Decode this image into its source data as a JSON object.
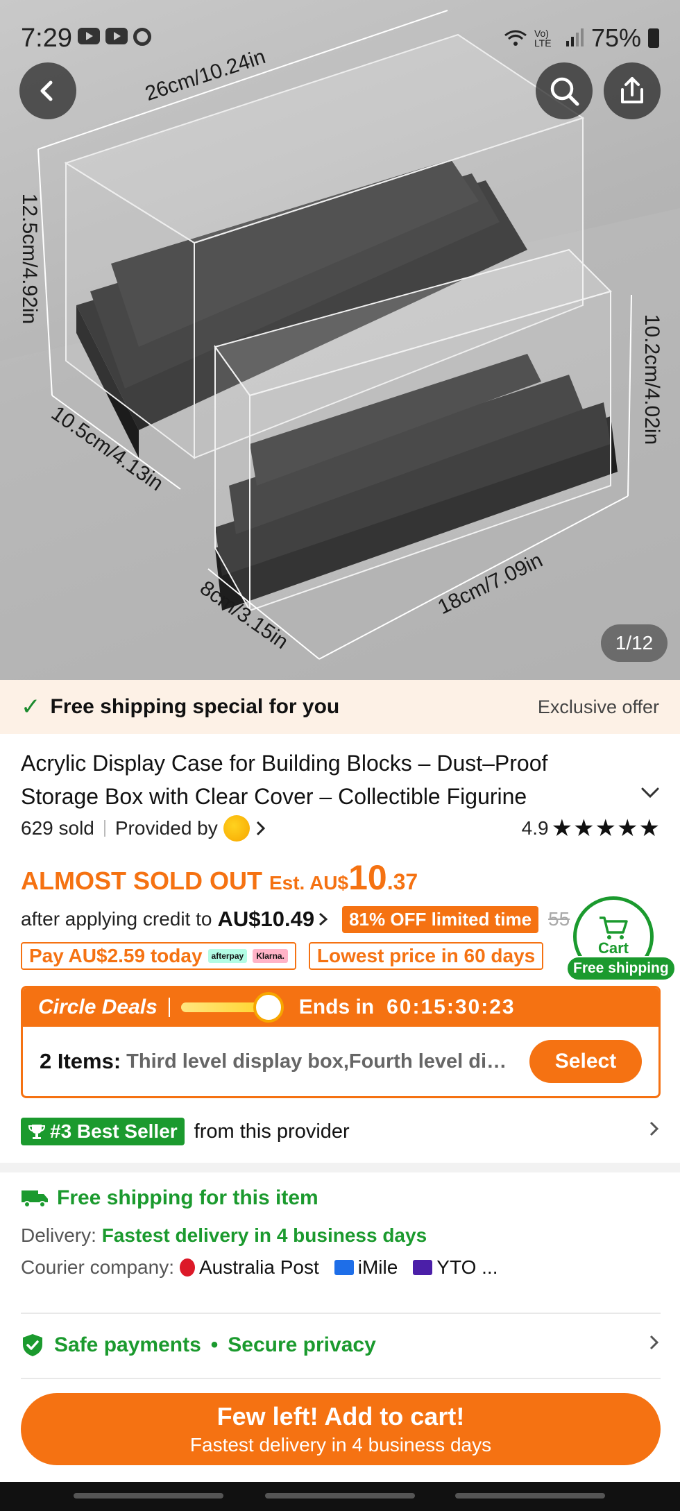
{
  "status_bar": {
    "time": "7:29",
    "signal_text": "Vo) LTE",
    "battery": "75%"
  },
  "hero": {
    "image_counter": "1/12",
    "dimensions": [
      "26cm/10.24in",
      "12.5cm/4.92in",
      "10.5cm/4.13in",
      "10.2cm/4.02in",
      "8cm/3.15in",
      "18cm/7.09in"
    ]
  },
  "banner": {
    "text": "Free shipping special for you",
    "offer": "Exclusive offer"
  },
  "product": {
    "title": "Acrylic Display Case for Building Blocks – Dust–Proof Storage Box with Clear Cover – Collectible Figurine Showcase",
    "sold": "629 sold",
    "provided_by": "Provided by",
    "rating": "4.9",
    "stars": "★★★★★"
  },
  "price": {
    "status": "ALMOST SOLD OUT",
    "est": "Est. AU$",
    "whole": "10",
    "cents": ".37",
    "credit_text": "after applying credit to",
    "credit_price": "AU$10.49",
    "off_badge": "81% OFF limited time",
    "original": "55",
    "pay_today": "Pay AU$2.59 today",
    "afterpay": "afterpay",
    "klarna": "Klarna.",
    "lowest": "Lowest price in 60 days"
  },
  "cart_float": {
    "label": "Cart",
    "shipping": "Free shipping"
  },
  "deals": {
    "name": "Circle Deals",
    "ends_label": "Ends in",
    "timer": "60:15:30:23",
    "items_label": "2 Items:",
    "items_desc": "Third level display box,Fourth level display box",
    "select": "Select"
  },
  "best_seller": {
    "badge": "#3 Best Seller",
    "from": "from this provider"
  },
  "shipping": {
    "free": "Free shipping for this item",
    "delivery_label": "Delivery:",
    "delivery_value": "Fastest delivery in 4 business days",
    "courier_label": "Courier company:",
    "couriers": [
      "Australia Post",
      "iMile",
      "YTO ..."
    ]
  },
  "safe": {
    "payments": "Safe payments",
    "privacy": "Secure privacy"
  },
  "cta": {
    "line1": "Few left! Add to cart!",
    "line2": "Fastest delivery in 4 business days"
  },
  "colors": {
    "accent": "#f57212",
    "green": "#1b9a2e"
  }
}
